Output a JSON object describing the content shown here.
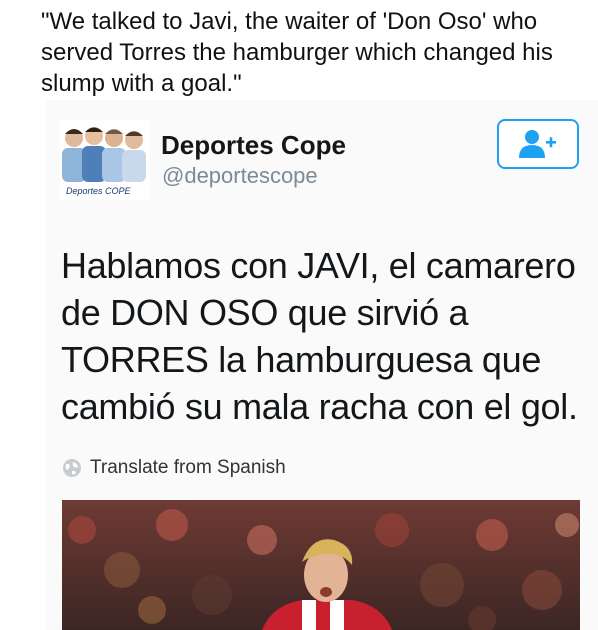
{
  "caption": "\"We talked to Javi, the waiter of 'Don Oso' who served Torres the hamburger which changed his slump with a goal.\"",
  "tweet": {
    "avatar_caption": "Deportes COPE",
    "display_name": "Deportes Cope",
    "handle": "@deportescope",
    "follow_icon": "add-user-icon",
    "text": "Hablamos con JAVI, el camarero de DON OSO que sirvió a TORRES la hamburguesa que cambió su mala racha con el gol.",
    "translate_label": "Translate from Spanish",
    "translate_icon": "globe-icon",
    "accent_color": "#1da1f2"
  }
}
